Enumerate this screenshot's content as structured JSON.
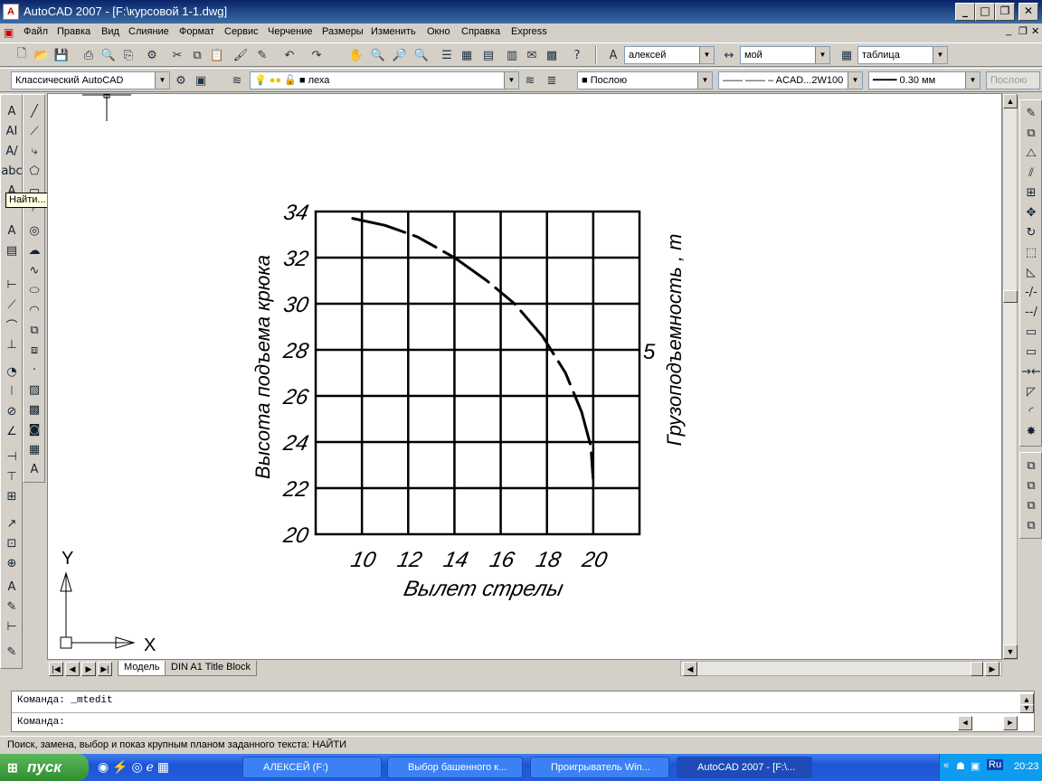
{
  "window": {
    "title": "AutoCAD 2007 - [F:\\курсовой 1-1.dwg]",
    "app_icon": "A"
  },
  "menu": [
    "Файл",
    "Правка",
    "Вид",
    "Слияние",
    "Формат",
    "Сервис",
    "Черчение",
    "Размеры",
    "Изменить",
    "Окно",
    "Справка",
    "Express"
  ],
  "toolbar_std": {
    "text_style": "алексей",
    "dim_style": "мой",
    "table_style": "таблица"
  },
  "toolbar_props": {
    "workspace": "Классический AutoCAD",
    "layer": "леха",
    "color": "Послою",
    "linetype": "—— —— – ACAD...2W100",
    "lineweight": "0.30 мм",
    "plotstyle": "Послою"
  },
  "tooltip": "Найти...",
  "chart_data": {
    "type": "line",
    "title": "",
    "xlabel": "Вылет стрелы",
    "ylabel": "Высота подъема крюка",
    "y2label": "Грузоподъемность , т",
    "xticks": [
      "10",
      "12",
      "14",
      "16",
      "18",
      "20"
    ],
    "yticks": [
      "20",
      "22",
      "24",
      "26",
      "28",
      "30",
      "32",
      "34"
    ],
    "y2ticks": [
      "5"
    ],
    "xlim": [
      8,
      22
    ],
    "ylim": [
      20,
      34
    ],
    "grid": true,
    "series": [
      {
        "line_style": "dashed",
        "x": [
          9.6,
          11.0,
          12.4,
          14.0,
          15.4,
          16.6,
          17.8,
          18.8,
          19.5,
          19.9,
          20.0
        ],
        "y": [
          33.7,
          33.4,
          32.9,
          32.0,
          31.0,
          30.0,
          28.6,
          27.0,
          25.3,
          23.8,
          22.3
        ]
      }
    ]
  },
  "axes_icon": {
    "y": "Y",
    "x": "X"
  },
  "layout_tabs": [
    "Модель",
    "DIN A1 Title Block"
  ],
  "command": {
    "line1": "Команда:  _mtedit",
    "line2": "Команда:"
  },
  "status": "Поиск, замена, выбор и показ крупным планом заданного текста:  НАЙТИ",
  "taskbar": {
    "start": "пуск",
    "tasks": [
      "АЛЕКСЕЙ (F:)",
      "Выбор башенного к...",
      "Проигрыватель Win...",
      "AutoCAD 2007 - [F:\\..."
    ],
    "lang": "Ru",
    "clock": "20:23"
  }
}
